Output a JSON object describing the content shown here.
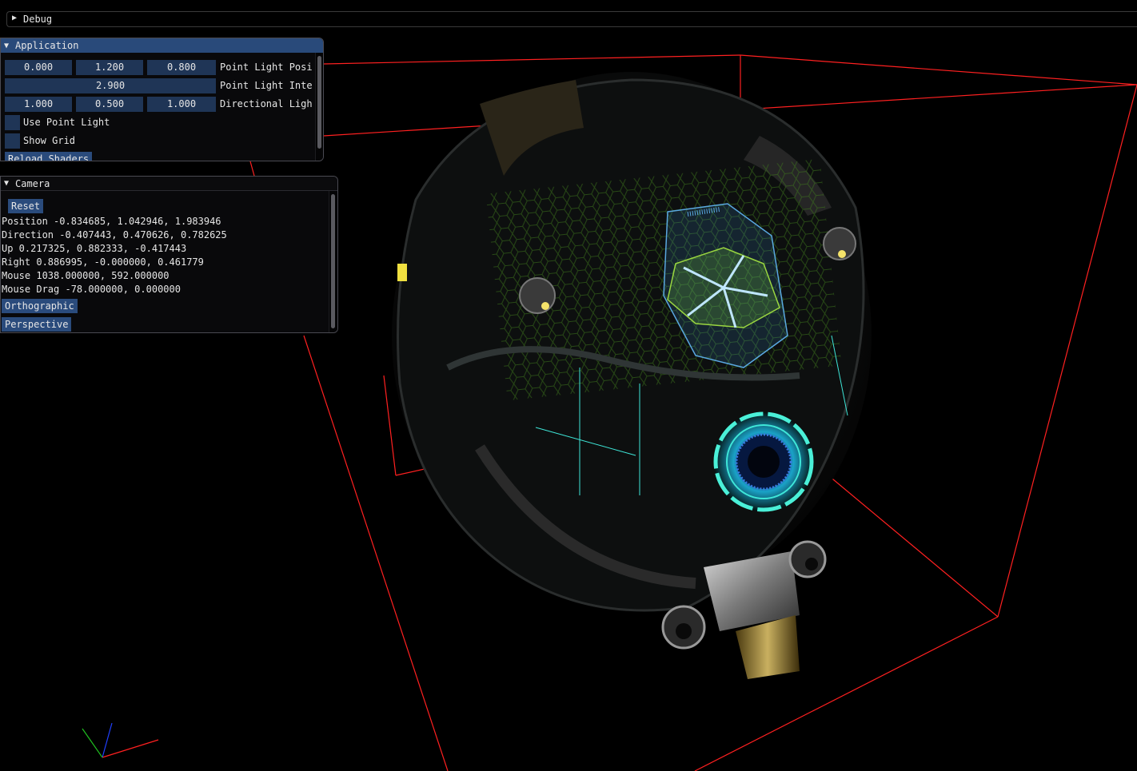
{
  "debug": {
    "title": "Debug"
  },
  "application": {
    "title": "Application",
    "point_light_position": {
      "values": [
        "0.000",
        "1.200",
        "0.800"
      ],
      "label": "Point Light Posi"
    },
    "point_light_intensity": {
      "value": "2.900",
      "label": "Point Light Inte"
    },
    "directional_light": {
      "values": [
        "1.000",
        "0.500",
        "1.000"
      ],
      "label": "Directional Ligh"
    },
    "use_point_light": {
      "label": "Use Point Light",
      "checked": false
    },
    "show_grid": {
      "label": "Show Grid",
      "checked": false
    },
    "reload_shaders": "Reload Shaders"
  },
  "camera": {
    "title": "Camera",
    "reset": "Reset",
    "position": "Position -0.834685, 1.042946, 1.983946",
    "direction": "Direction -0.407443, 0.470626, 0.782625",
    "up": "Up 0.217325, 0.882333, -0.417443",
    "right": "Right 0.886995, -0.000000, 0.461779",
    "mouse": "Mouse 1038.000000, 592.000000",
    "mouse_drag": "Mouse Drag -78.000000, 0.000000",
    "orthographic": "Orthographic",
    "perspective": "Perspective"
  },
  "colors": {
    "bounding_box": "#ff2020",
    "title_active": "#294a7a",
    "frame_bg": "#1f3556",
    "button": "#2a4b7c",
    "hud_cyan": "#3ee6d8",
    "hud_green": "#7dcc3a"
  }
}
